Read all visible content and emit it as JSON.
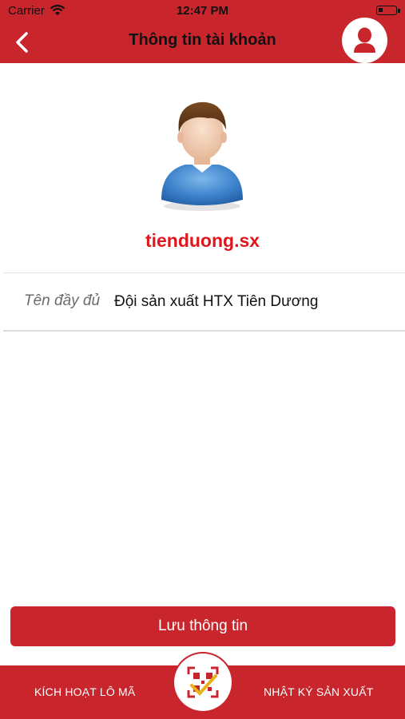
{
  "statusbar": {
    "carrier": "Carrier",
    "time": "12:47 PM"
  },
  "header": {
    "title": "Thông tin tài khoản",
    "back_icon": "chevron-left-icon",
    "account_icon": "user-icon"
  },
  "profile": {
    "username": "tienduong.sx",
    "avatar_icon": "default-avatar"
  },
  "fields": [
    {
      "label": "Tên đầy đủ",
      "value": "Đội sản xuất HTX Tiên Dương"
    }
  ],
  "actions": {
    "save_label": "Lưu thông tin"
  },
  "bottom_nav": {
    "left_label": "KÍCH HOẠT LÔ MÃ",
    "right_label": "NHẬT KÝ SẢN XUẤT",
    "center_icon": "qr-scan-icon"
  },
  "colors": {
    "brand": "#c9252c",
    "username": "#e0161e"
  }
}
